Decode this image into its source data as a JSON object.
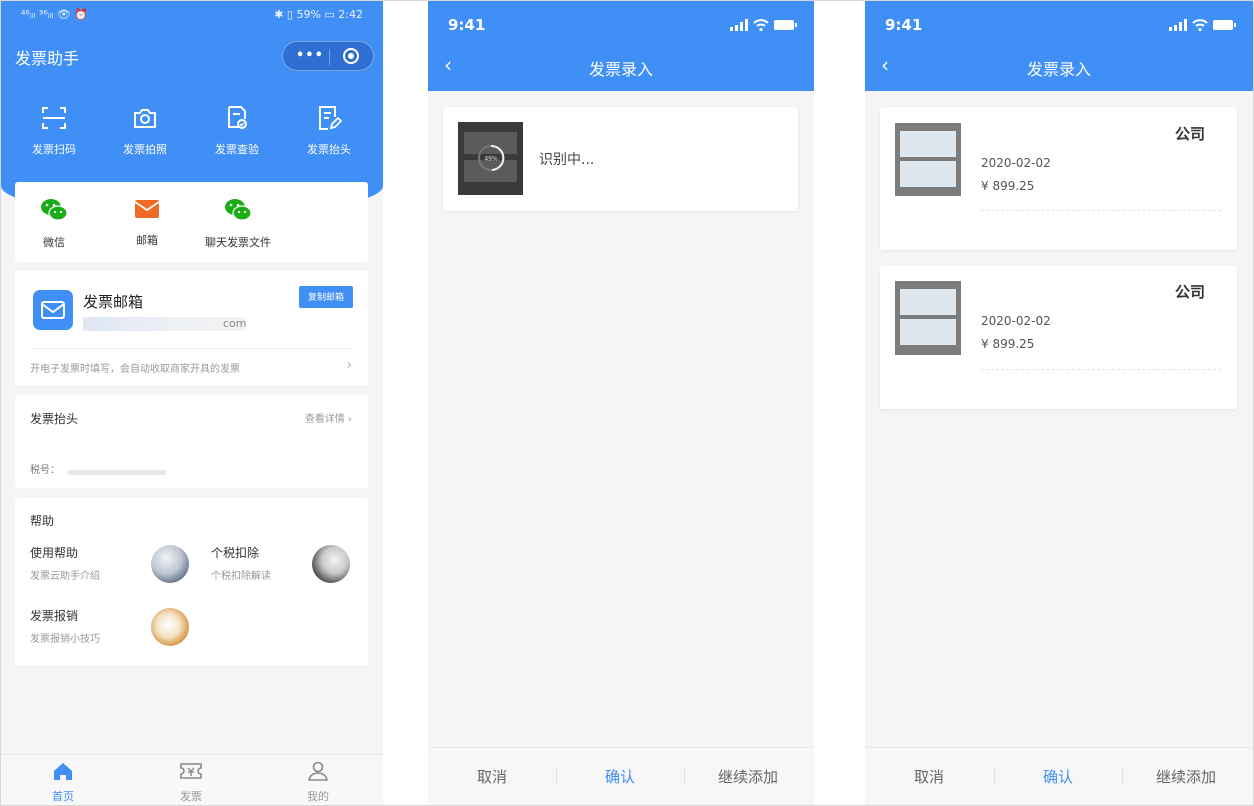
{
  "home": {
    "status_bar": {
      "left": "⁴⁶ᵢₗₗ ³⁶ᵢₗₗ 👁 ⏰",
      "right": "✱ ▯ 59% ▭ 2:42"
    },
    "title": "发票助手",
    "quick_actions": [
      {
        "label": "发票扫码",
        "icon": "scan-icon"
      },
      {
        "label": "发票拍照",
        "icon": "camera-icon"
      },
      {
        "label": "发票查验",
        "icon": "verify-icon"
      },
      {
        "label": "发票抬头",
        "icon": "edit-header-icon"
      }
    ],
    "share_sources": [
      {
        "label": "微信",
        "icon": "wechat-icon",
        "color": "#1aad19"
      },
      {
        "label": "邮箱",
        "icon": "mail-icon",
        "color": "#f06a25"
      },
      {
        "label": "聊天发票文件",
        "icon": "wechat-icon",
        "color": "#1aad19"
      }
    ],
    "mailbox": {
      "title": "发票邮箱",
      "address_tail": "com",
      "copy_label": "复制邮箱",
      "hint": "开电子发票时填写，会自动收取商家开具的发票"
    },
    "invoice_header": {
      "title": "发票抬头",
      "detail_label": "查看详情",
      "tax_label": "税号："
    },
    "help": {
      "title": "帮助",
      "items": [
        {
          "title": "使用帮助",
          "subtitle": "发票云助手介绍"
        },
        {
          "title": "个税扣除",
          "subtitle": "个税扣除解读"
        },
        {
          "title": "发票报销",
          "subtitle": "发票报销小技巧"
        }
      ]
    },
    "tabs": [
      {
        "label": "首页",
        "active": true
      },
      {
        "label": "发票",
        "active": false
      },
      {
        "label": "我的",
        "active": false
      }
    ]
  },
  "entry_recognizing": {
    "time": "9:41",
    "nav_title": "发票录入",
    "progress_label": "49%",
    "status": "识别中...",
    "buttons": {
      "cancel": "取消",
      "confirm": "确认",
      "add_more": "继续添加"
    }
  },
  "entry_results": {
    "time": "9:41",
    "nav_title": "发票录入",
    "invoices": [
      {
        "company": "公司",
        "date": "2020-02-02",
        "amount": "¥ 899.25"
      },
      {
        "company": "公司",
        "date": "2020-02-02",
        "amount": "¥ 899.25"
      }
    ],
    "buttons": {
      "cancel": "取消",
      "confirm": "确认",
      "add_more": "继续添加"
    }
  },
  "colors": {
    "primary": "#3f8ff7",
    "wechat": "#1aad19",
    "mail": "#f06a25",
    "background": "#f5f5f7"
  }
}
